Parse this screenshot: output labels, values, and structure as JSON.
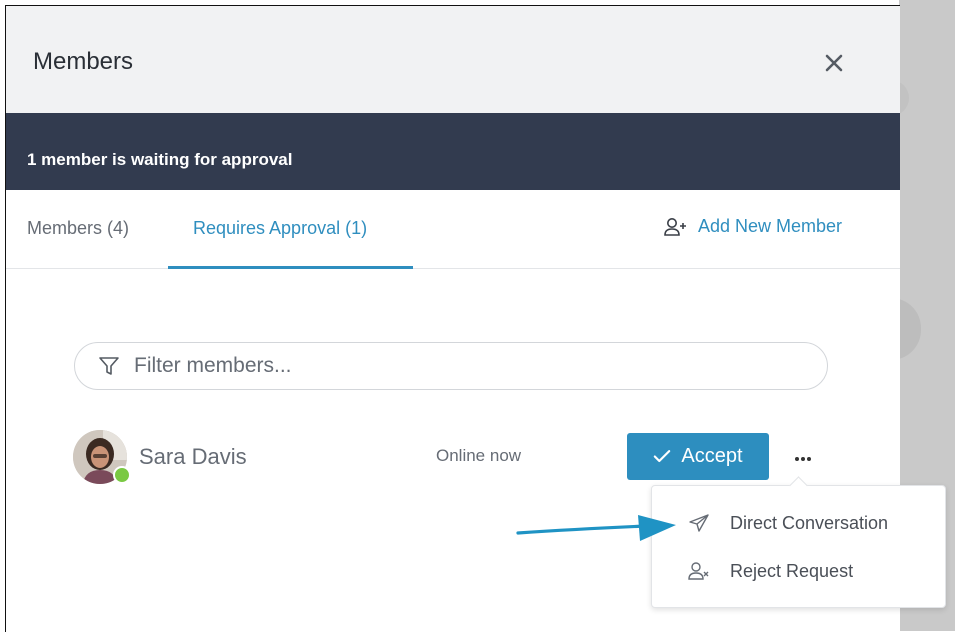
{
  "dialog": {
    "title": "Members",
    "close_icon": "close-icon"
  },
  "banner": {
    "text": "1 member is waiting for approval"
  },
  "tabs": {
    "members_label": "Members (4)",
    "approval_label": "Requires Approval (1)",
    "active": "approval"
  },
  "add_member": {
    "label": "Add New Member",
    "icon": "user-plus-icon"
  },
  "filter": {
    "placeholder": "Filter members...",
    "value": "",
    "icon": "filter-icon"
  },
  "member": {
    "name": "Sara Davis",
    "status": "Online now",
    "online": true
  },
  "actions": {
    "accept_label": "Accept",
    "more_icon": "more-horizontal-icon"
  },
  "menu": {
    "items": [
      {
        "label": "Direct Conversation",
        "icon": "send-icon"
      },
      {
        "label": "Reject Request",
        "icon": "user-x-icon"
      }
    ]
  },
  "colors": {
    "accent": "#2f8ebf",
    "banner": "#323b4f",
    "online": "#7ac943"
  }
}
